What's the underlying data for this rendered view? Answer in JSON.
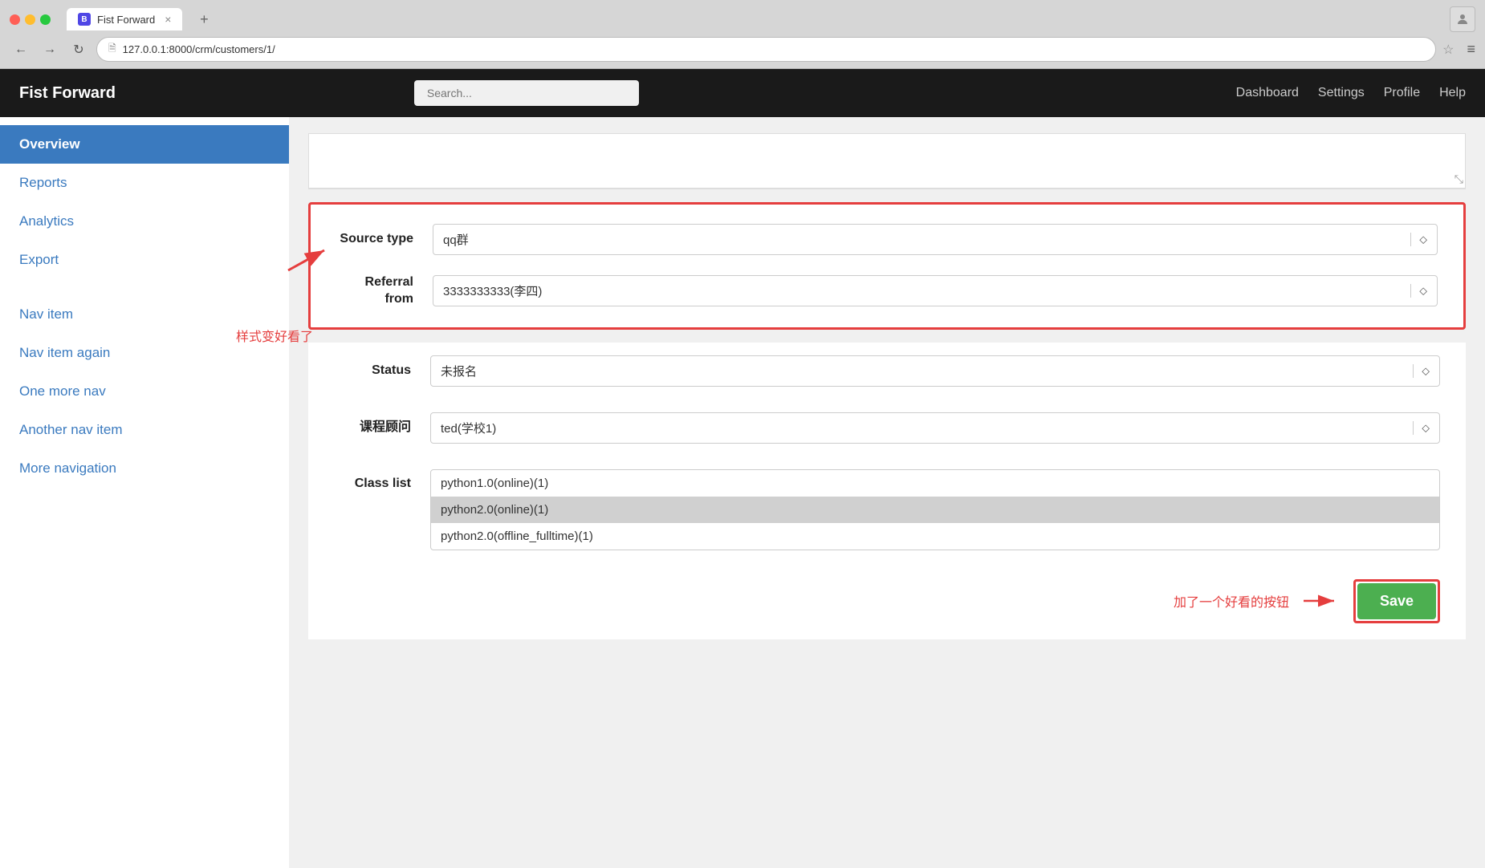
{
  "browser": {
    "dots": [
      "red",
      "yellow",
      "green"
    ],
    "tab_favicon": "B",
    "tab_title": "Fist Forward",
    "tab_close": "×",
    "new_tab_icon": "+",
    "back_icon": "←",
    "forward_icon": "→",
    "refresh_icon": "↻",
    "url": "127.0.0.1:8000/crm/customers/1/",
    "bookmark_icon": "☆",
    "menu_icon": "≡",
    "profile_icon": "👤"
  },
  "header": {
    "logo": "Fist Forward",
    "search_placeholder": "Search...",
    "nav_items": [
      "Dashboard",
      "Settings",
      "Profile",
      "Help"
    ]
  },
  "sidebar": {
    "items": [
      {
        "label": "Overview",
        "active": true
      },
      {
        "label": "Reports",
        "active": false
      },
      {
        "label": "Analytics",
        "active": false
      },
      {
        "label": "Export",
        "active": false
      },
      {
        "label": "Nav item",
        "active": false
      },
      {
        "label": "Nav item again",
        "active": false
      },
      {
        "label": "One more nav",
        "active": false
      },
      {
        "label": "Another nav item",
        "active": false
      },
      {
        "label": "More navigation",
        "active": false
      }
    ],
    "note": "样式变好看了"
  },
  "form": {
    "source_type_label": "Source type",
    "source_type_value": "qq群",
    "referral_from_label": "Referral from",
    "referral_from_value": "3333333333(李四)",
    "status_label": "Status",
    "status_value": "未报名",
    "advisor_label": "课程顾问",
    "advisor_value": "ted(学校1)",
    "class_list_label": "Class list",
    "class_list_items": [
      {
        "label": "python1.0(online)(1)",
        "selected": false
      },
      {
        "label": "python2.0(online)(1)",
        "selected": true
      },
      {
        "label": "python2.0(offline_fulltime)(1)",
        "selected": false
      }
    ],
    "dropdown_icon": "⬦",
    "resize_icon": "⤡"
  },
  "save_area": {
    "note": "加了一个好看的按钮",
    "arrow": "→",
    "save_label": "Save"
  }
}
